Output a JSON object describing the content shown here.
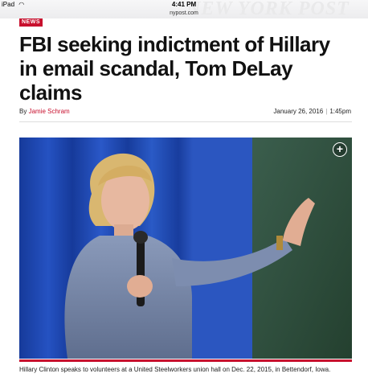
{
  "status_bar": {
    "device": "iPad",
    "time": "4:41 PM",
    "url": "nypost.com"
  },
  "masthead": {
    "brand": "NEW YORK POST"
  },
  "article": {
    "section_badge": "NEWS",
    "headline": "FBI seeking indictment of Hillary in email scandal, Tom DeLay claims",
    "byline_prefix": "By",
    "author": "Jamie Schram",
    "date": "January 26, 2016",
    "time": "1:45pm",
    "caption": "Hillary Clinton speaks to volunteers at a United Steelworkers union hall on Dec. 22, 2015, in Bettendorf, Iowa."
  },
  "icons": {
    "expand": "plus-circle-icon",
    "wifi": "wifi-icon"
  },
  "colors": {
    "accent": "#c8102e",
    "curtain": "#1b3d8f",
    "chalkboard": "#2c4a3a"
  }
}
